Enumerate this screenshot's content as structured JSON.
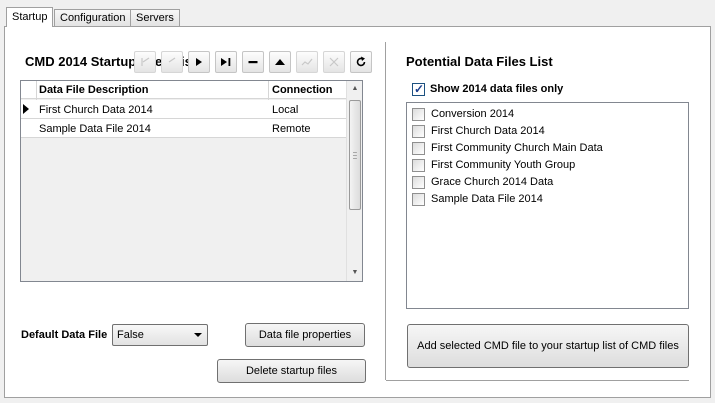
{
  "tabs": [
    {
      "label": "Startup",
      "active": true
    },
    {
      "label": "Configuration",
      "active": false
    },
    {
      "label": "Servers",
      "active": false
    }
  ],
  "startup_list": {
    "title": "CMD 2014 Startup Files List",
    "nav_buttons": [
      {
        "icon": "first-record-icon",
        "enabled": false
      },
      {
        "icon": "prior-record-icon",
        "enabled": false
      },
      {
        "icon": "next-record-icon",
        "enabled": true
      },
      {
        "icon": "last-record-icon",
        "enabled": true
      },
      {
        "icon": "delete-record-icon",
        "enabled": true
      },
      {
        "icon": "move-up-icon",
        "enabled": true
      },
      {
        "icon": "edit-record-icon",
        "enabled": false
      },
      {
        "icon": "cancel-edit-icon",
        "enabled": false
      },
      {
        "icon": "refresh-icon",
        "enabled": true
      }
    ],
    "columns": [
      "Data File Description",
      "Connection"
    ],
    "rows": [
      {
        "description": "First Church Data 2014",
        "connection": "Local",
        "current": true
      },
      {
        "description": "Sample Data File 2014",
        "connection": "Remote",
        "current": false
      }
    ],
    "default_label": "Default Data File",
    "default_value": "False",
    "properties_button": "Data file properties",
    "delete_button": "Delete startup files"
  },
  "potential_list": {
    "title": "Potential Data Files List",
    "show_only_label": "Show 2014 data files only",
    "show_only_checked": true,
    "items": [
      {
        "label": "Conversion 2014",
        "checked": false
      },
      {
        "label": "First Church Data 2014",
        "checked": false
      },
      {
        "label": "First Community Church Main Data",
        "checked": false
      },
      {
        "label": "First Community Youth Group",
        "checked": false
      },
      {
        "label": "Grace Church 2014 Data",
        "checked": false
      },
      {
        "label": "Sample Data File 2014",
        "checked": false
      }
    ],
    "add_button": "Add selected CMD file to your startup list of CMD files"
  }
}
